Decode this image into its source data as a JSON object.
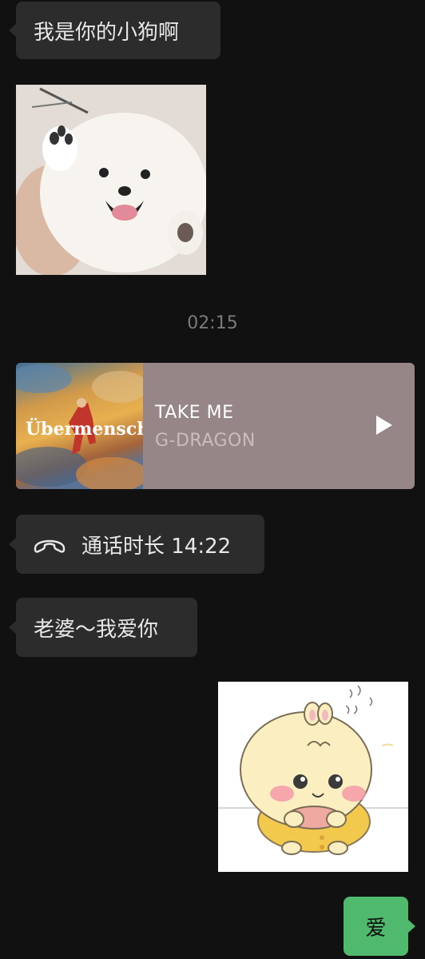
{
  "messages": {
    "first_text": "我是你的小狗啊",
    "timestamp": "02:15",
    "call_text": "通话时长 14:22",
    "love_text": "老婆～我爱你",
    "reply_text": "爱"
  },
  "music": {
    "album_text": "Übermensch",
    "title": "TAKE ME",
    "artist": "G-DRAGON"
  },
  "icons": {
    "play": "play-icon",
    "phone": "phone-hangup-icon"
  },
  "colors": {
    "background": "#111111",
    "incoming_bubble": "#2c2c2c",
    "outgoing_bubble": "#4fb96d",
    "music_card": "#968687"
  }
}
